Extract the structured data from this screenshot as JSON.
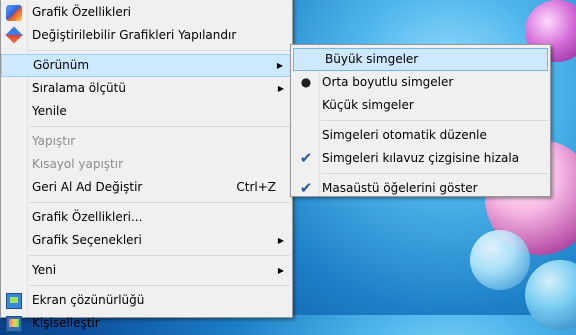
{
  "main_menu": {
    "items": [
      {
        "label": "Grafik Özellikleri"
      },
      {
        "label": "Değiştirilebilir Grafikleri Yapılandır"
      },
      {
        "label": "Görünüm"
      },
      {
        "label": "Sıralama ölçütü"
      },
      {
        "label": "Yenile"
      },
      {
        "label": "Yapıştır"
      },
      {
        "label": "Kısayol yapıştır"
      },
      {
        "label": "Geri Al Ad Değiştir",
        "shortcut": "Ctrl+Z"
      },
      {
        "label": "Grafik Özellikleri..."
      },
      {
        "label": "Grafik Seçenekleri"
      },
      {
        "label": "Yeni"
      },
      {
        "label": "Ekran çözünürlüğü"
      },
      {
        "label": "Kişiselleştir"
      }
    ]
  },
  "sub_menu": {
    "items": [
      {
        "label": "Büyük simgeler"
      },
      {
        "label": "Orta boyutlu simgeler"
      },
      {
        "label": "Küçük simgeler"
      },
      {
        "label": "Simgeleri otomatik düzenle"
      },
      {
        "label": "Simgeleri kılavuz çizgisine hizala"
      },
      {
        "label": "Masaüstü öğelerini göster"
      }
    ]
  },
  "glyphs": {
    "submenu_arrow": "▶",
    "radio_dot": "●",
    "check": "✔"
  },
  "icons": {
    "grafik_properties": "graphics-properties-icon",
    "configure_graphics": "switchable-graphics-icon",
    "screen_resolution": "display-icon",
    "personalize": "personalize-icon"
  },
  "colors": {
    "menu_bg": "#f0f0f0",
    "highlight_bg": "#cde8ff",
    "highlight_border": "#99d1ff",
    "disabled_text": "#8c8c8c"
  }
}
